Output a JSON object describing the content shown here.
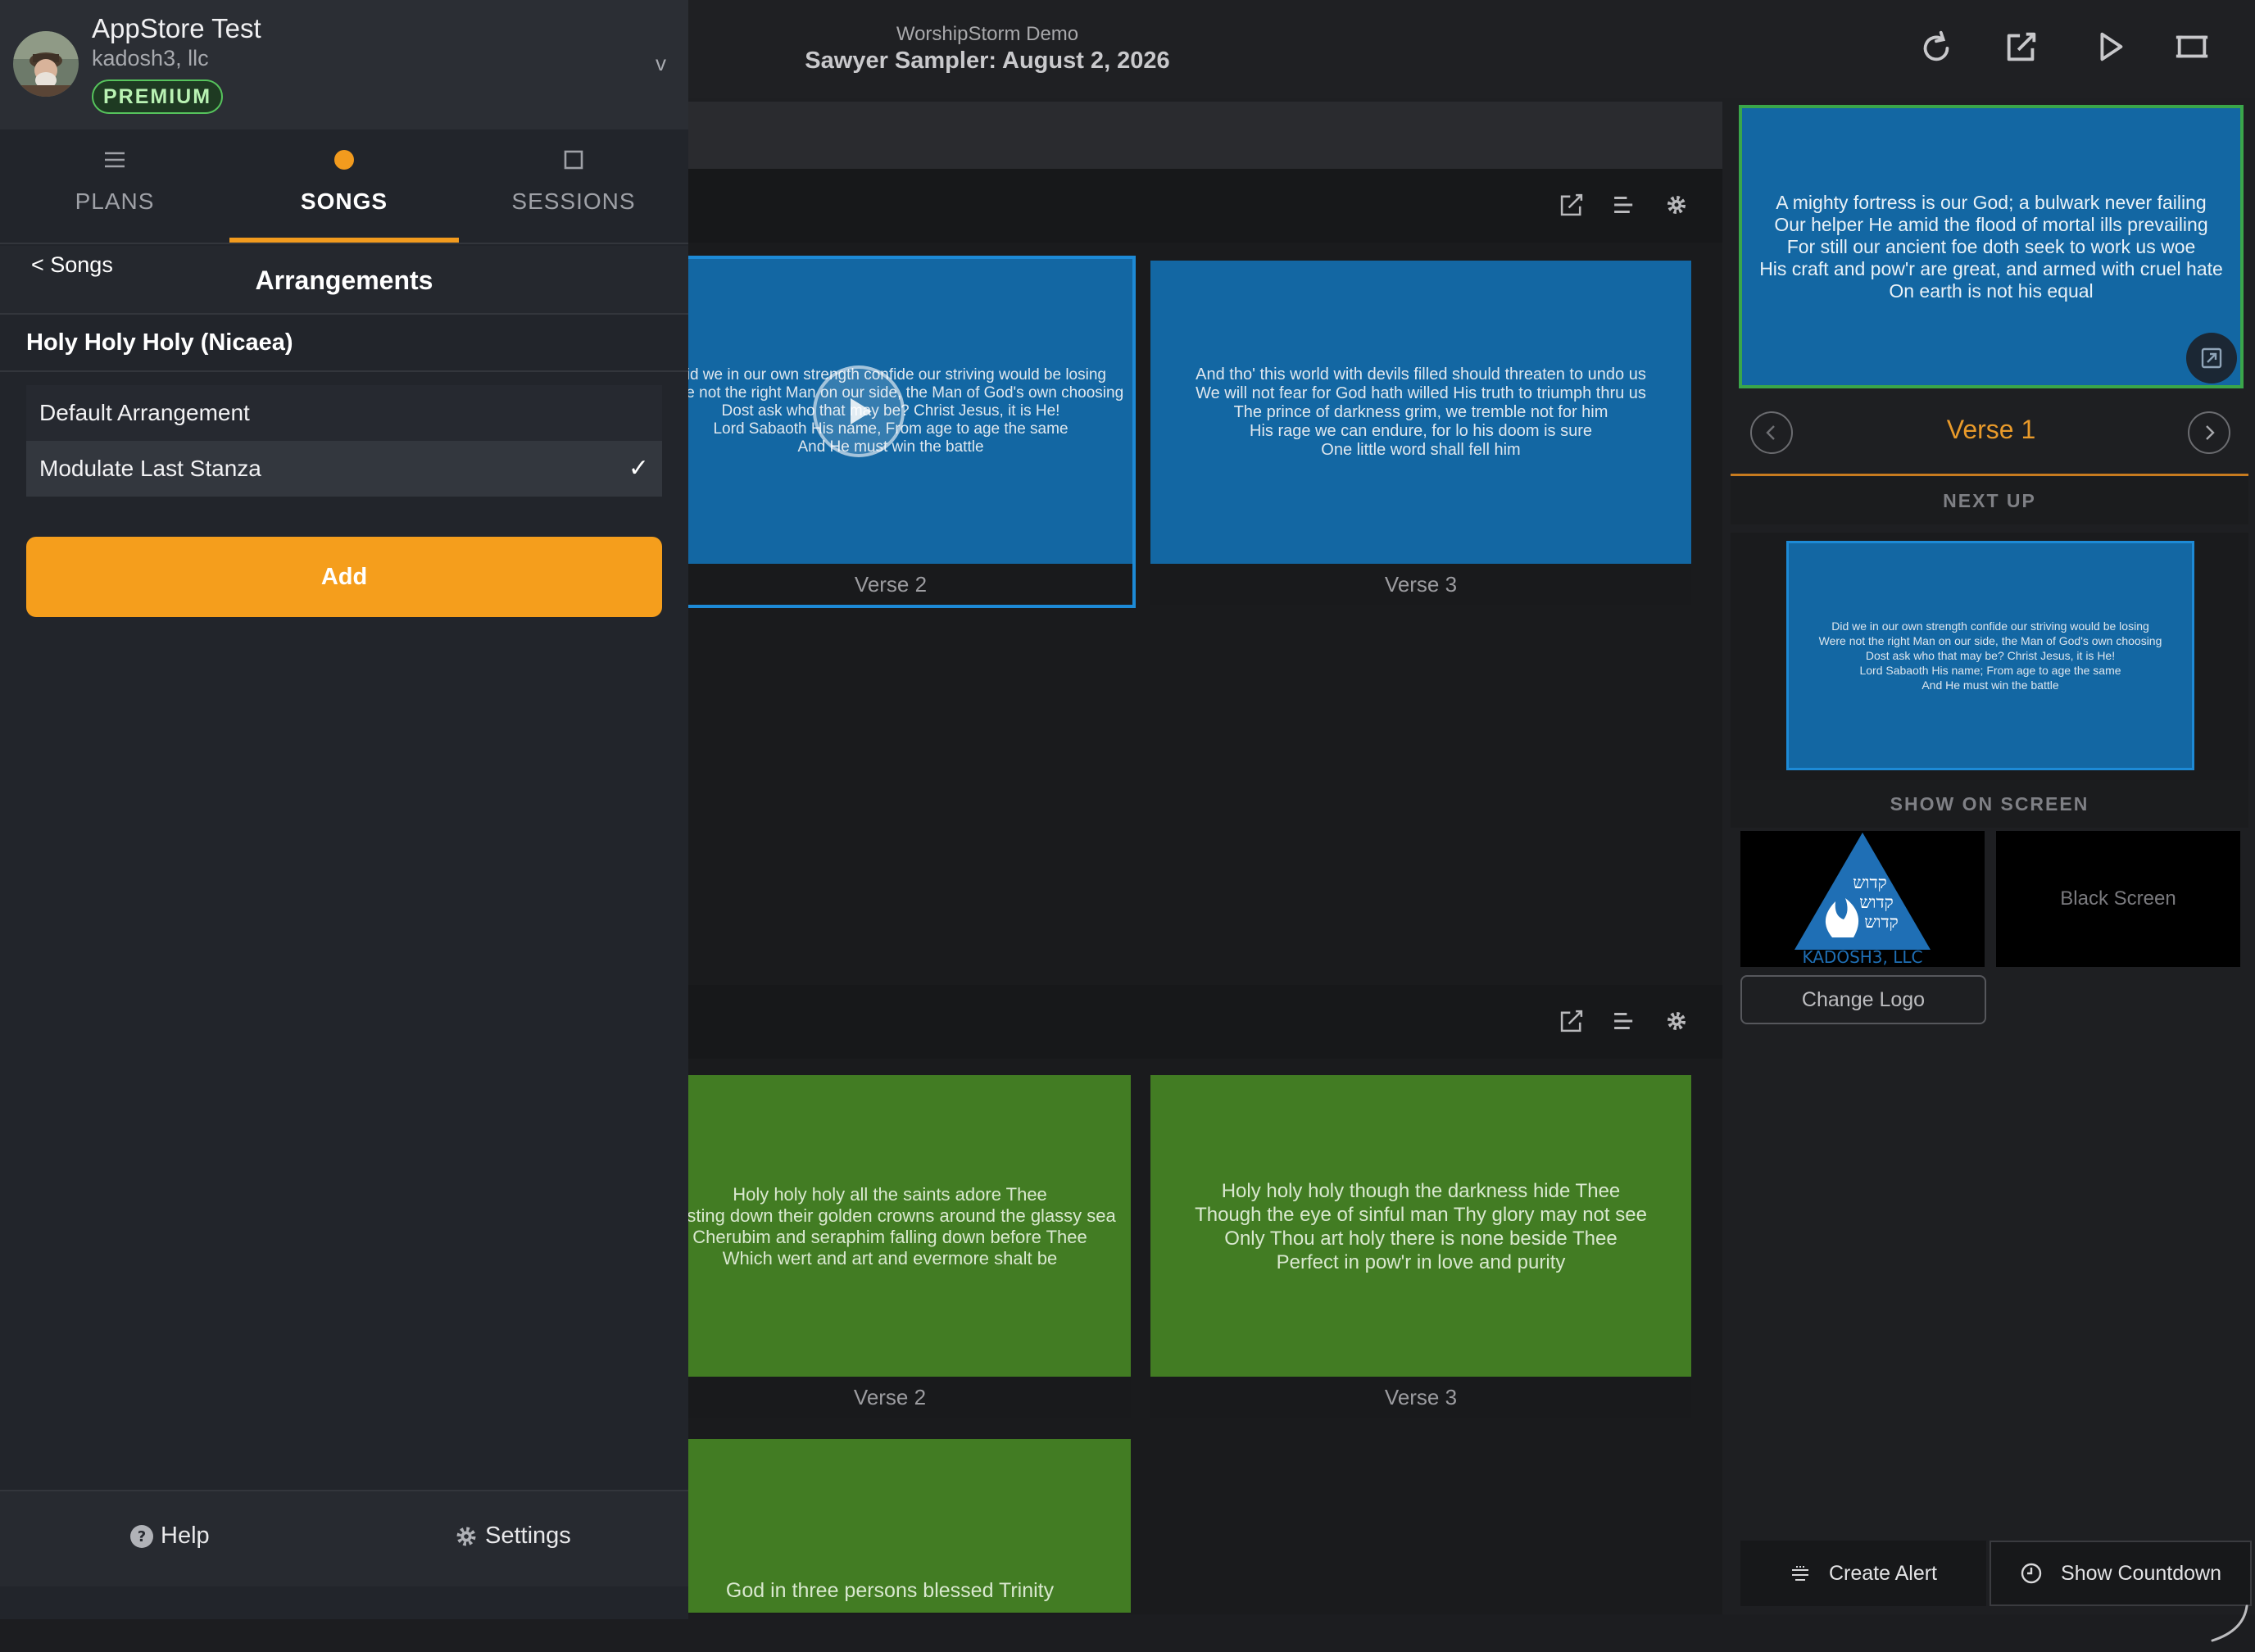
{
  "header": {
    "subtitle": "WorshipStorm Demo",
    "title": "Sawyer Sampler: August 2, 2026",
    "icons": [
      "refresh-icon",
      "external-edit-icon",
      "play-icon",
      "present-screen-icon"
    ]
  },
  "main": {
    "section1": {
      "slides": [
        {
          "label": "Verse 2",
          "lines": [
            "Did we in our own strength confide our striving would be losing",
            "Were not the right Man on our side, the Man of God's own choosing",
            "Dost ask who that may be? Christ Jesus, it is He!",
            "Lord Sabaoth His name, From age to age the same",
            "And He must win the battle"
          ]
        },
        {
          "label": "Verse 3",
          "lines": [
            "And tho' this world with devils filled should threaten to undo us",
            "We will not fear for God hath willed His truth to triumph thru us",
            "The prince of darkness grim, we tremble not for him",
            "His rage we can endure, for lo his doom is sure",
            "One little word shall fell him"
          ]
        }
      ]
    },
    "section2": {
      "slides": [
        {
          "label": "Verse 2",
          "lines": [
            "Holy holy holy all the saints adore Thee",
            "Casting down their golden crowns around the glassy sea",
            "Cherubim and seraphim falling down before Thee",
            "Which wert and art and evermore shalt be"
          ]
        },
        {
          "label": "Verse 3",
          "lines": [
            "Holy holy holy though the darkness hide Thee",
            "Though the eye of sinful man Thy glory may not see",
            "Only Thou art holy there is none beside Thee",
            "Perfect in pow'r in love and purity"
          ]
        },
        {
          "label": "",
          "lines": [
            "God in three persons blessed Trinity"
          ]
        }
      ]
    }
  },
  "right_panel": {
    "live": {
      "lines": [
        "A mighty fortress is our God; a bulwark never failing",
        "Our helper He amid the flood of mortal ills prevailing",
        "For still our ancient foe doth seek to work us woe",
        "His craft and pow'r are great, and armed with cruel hate",
        "On earth is not his equal"
      ]
    },
    "current_label": "Verse 1",
    "next_up_heading": "NEXT UP",
    "next_up": {
      "lines": [
        "Did we in our own strength confide our striving would be losing",
        "Were not the right Man on our side, the Man of God's own choosing",
        "Dost ask who that may be? Christ Jesus, it is He!",
        "Lord Sabaoth His name; From age to age the same",
        "And He must win the battle"
      ]
    },
    "show_on_screen_heading": "SHOW ON SCREEN",
    "logo_text": "KADOSH3, LLC",
    "logo_hebrew": [
      "קדוש",
      "קדוש",
      "קדוש"
    ],
    "black_screen_label": "Black Screen",
    "change_logo_label": "Change Logo",
    "create_alert_label": "Create Alert",
    "show_countdown_label": "Show Countdown"
  },
  "sidebar": {
    "account": {
      "name": "AppStore Test",
      "org": "kadosh3, llc",
      "badge": "PREMIUM",
      "chevron": "v"
    },
    "tabs": [
      {
        "label": "PLANS",
        "icon": "list-icon"
      },
      {
        "label": "SONGS",
        "icon": "dot-icon",
        "active": true
      },
      {
        "label": "SESSIONS",
        "icon": "square-icon"
      }
    ],
    "back_label": "< Songs",
    "arrangements_title": "Arrangements",
    "song_title": "Holy Holy Holy (Nicaea)",
    "arrangements": [
      {
        "label": "Default Arrangement",
        "selected": false
      },
      {
        "label": "Modulate Last Stanza",
        "selected": true
      }
    ],
    "checkmark": "✓",
    "add_label": "Add",
    "help_label": "Help",
    "settings_label": "Settings"
  },
  "colors": {
    "accent": "#f59e1c",
    "slide_blue": "#1367a3",
    "slide_green": "#427c23",
    "live_border": "#3aa64a",
    "selection": "#1d8ad6"
  }
}
